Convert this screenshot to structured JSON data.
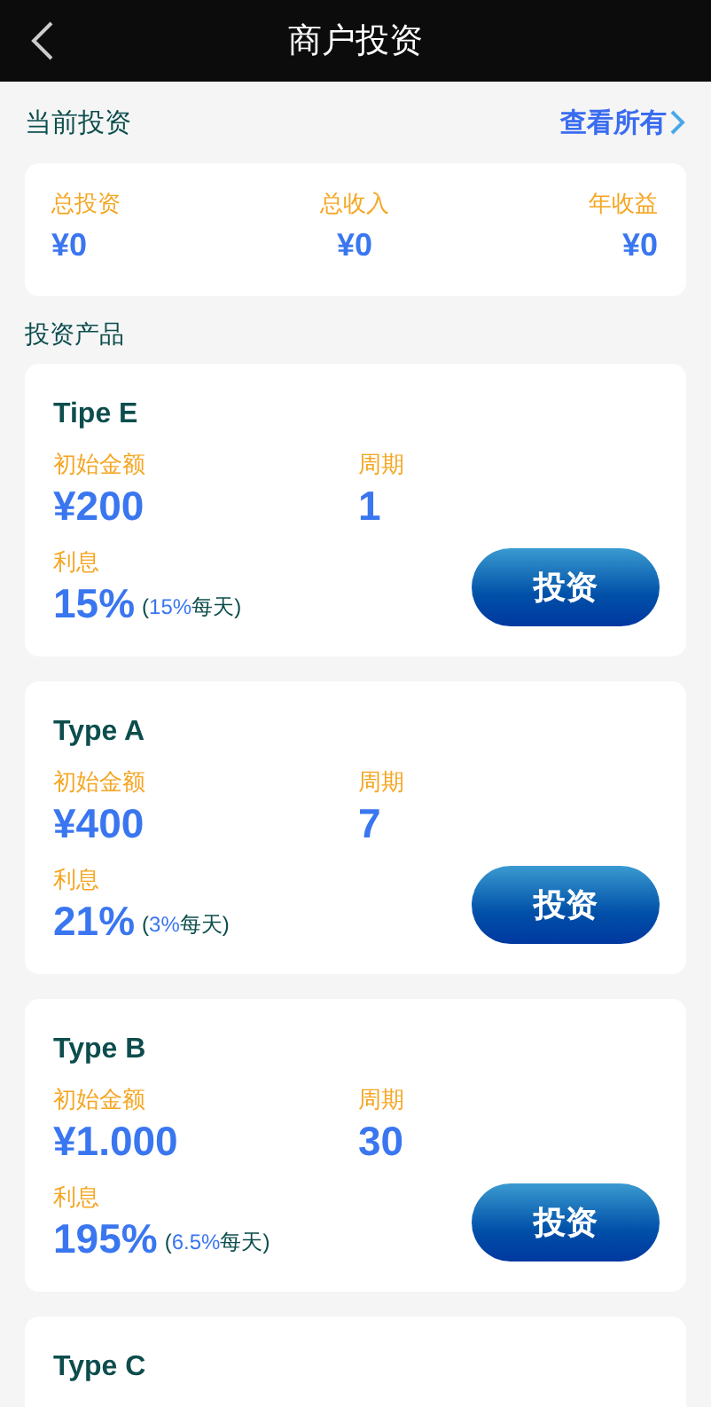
{
  "header": {
    "title": "商户投资"
  },
  "current": {
    "title": "当前投资",
    "link": "查看所有",
    "stats": [
      {
        "label": "总投资",
        "value": "¥0"
      },
      {
        "label": "总收入",
        "value": "¥0"
      },
      {
        "label": "年收益",
        "value": "¥0"
      }
    ]
  },
  "products_title": "投资产品",
  "products": [
    {
      "name": "Tipe E",
      "amount_label": "初始金额",
      "amount": "¥200",
      "period_label": "周期",
      "period": "1",
      "rate_label": "利息",
      "rate": "15%",
      "daily_open": "(",
      "daily_rate": "15%",
      "daily_unit": "每天)",
      "button": "投资"
    },
    {
      "name": "Type A",
      "amount_label": "初始金额",
      "amount": "¥400",
      "period_label": "周期",
      "period": "7",
      "rate_label": "利息",
      "rate": "21%",
      "daily_open": "(",
      "daily_rate": "3%",
      "daily_unit": "每天)",
      "button": "投资"
    },
    {
      "name": "Type B",
      "amount_label": "初始金额",
      "amount": "¥1.000",
      "period_label": "周期",
      "period": "30",
      "rate_label": "利息",
      "rate": "195%",
      "daily_open": "(",
      "daily_rate": "6.5%",
      "daily_unit": "每天)",
      "button": "投资"
    },
    {
      "name": "Type C"
    }
  ]
}
